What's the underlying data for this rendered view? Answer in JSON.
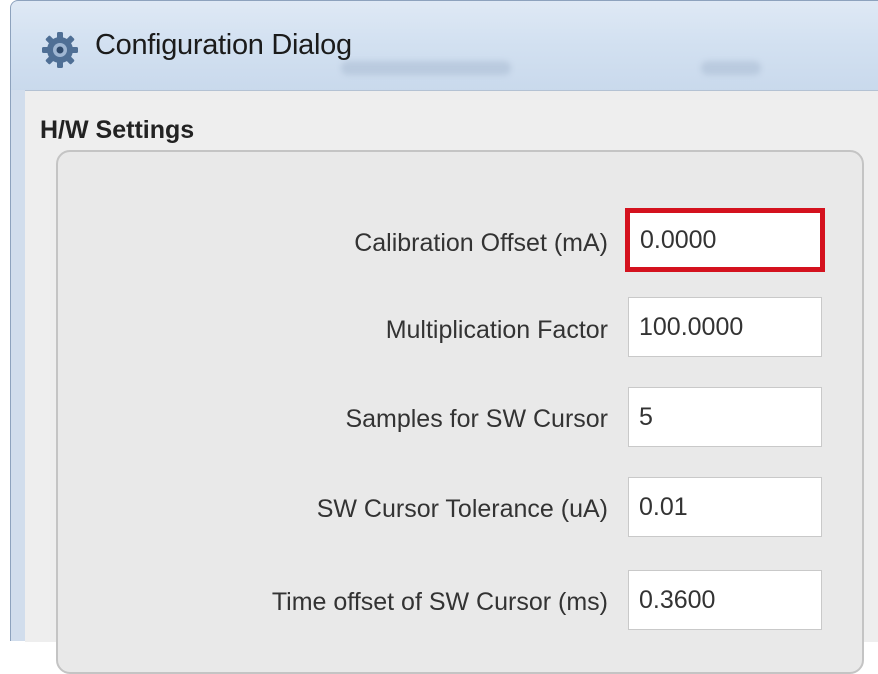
{
  "window": {
    "title": "Configuration Dialog",
    "icon": "gear-icon"
  },
  "group": {
    "title": "H/W Settings"
  },
  "fields": [
    {
      "label": "Calibration Offset (mA)",
      "value": "0.0000",
      "focused": true
    },
    {
      "label": "Multiplication Factor",
      "value": "100.0000"
    },
    {
      "label": "Samples for SW Cursor",
      "value": "5"
    },
    {
      "label": "SW Cursor Tolerance (uA)",
      "value": "0.01"
    },
    {
      "label": "Time offset of SW Cursor (ms)",
      "value": "0.3600"
    }
  ],
  "colors": {
    "focus_highlight": "#d4121e",
    "titlebar": "#d3e1f1",
    "dialog_background": "#eeeeee"
  }
}
